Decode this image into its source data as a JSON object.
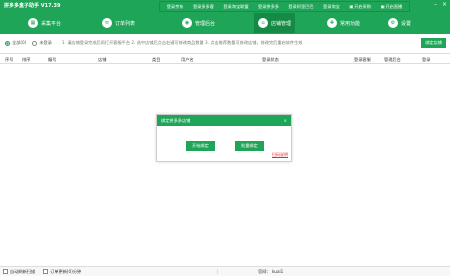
{
  "app": {
    "title": "拼多多盒子助手 V17.39"
  },
  "top_links": [
    {
      "label": "登录京东"
    },
    {
      "label": "登录多多客"
    },
    {
      "label": "登录淘宝联盟"
    },
    {
      "label": "登录拼多多"
    },
    {
      "label": "登录阿里巴巴"
    },
    {
      "label": "登录淘宝"
    },
    {
      "label": "开启采购"
    },
    {
      "label": "开启直播"
    }
  ],
  "nav": [
    {
      "label": "采集平台",
      "icon": "grid-icon"
    },
    {
      "label": "订单列表",
      "icon": "list-icon"
    },
    {
      "label": "管理后台",
      "icon": "admin-icon"
    },
    {
      "label": "店铺管理",
      "icon": "store-icon"
    },
    {
      "label": "常用功能",
      "icon": "toolbox-icon"
    },
    {
      "label": "设置",
      "icon": "gear-icon"
    }
  ],
  "filter": {
    "option_all": "全部(0)",
    "option_unlogged": "未登录",
    "hint": "1. 请店铺登录完成后再打开客服平台    2. 选中店铺后点击右键可修改商品数量    3. 点击推荐数量可修改店铺，修改完后重启软件生效",
    "bind_button": "绑定店铺"
  },
  "table": {
    "headers": [
      "序号",
      "排序",
      "编号",
      "店铺",
      "类目",
      "用户名",
      "登录状态",
      "登录客服",
      "管理后台",
      "登录"
    ]
  },
  "dialog": {
    "title": "绑定拼多多店铺",
    "close": "×",
    "start_button": "开始绑定",
    "batch_button": "批量绑定",
    "help_link": "扫码说明"
  },
  "status": {
    "auto_login": "自动刷新扫描",
    "order_refresh": "订单更新(0)分钟",
    "official_label": "官网：",
    "official_value": "kuai1"
  },
  "colors": {
    "primary": "#1fa558",
    "active_tab": "#148a45",
    "link_red": "#d9302c"
  }
}
